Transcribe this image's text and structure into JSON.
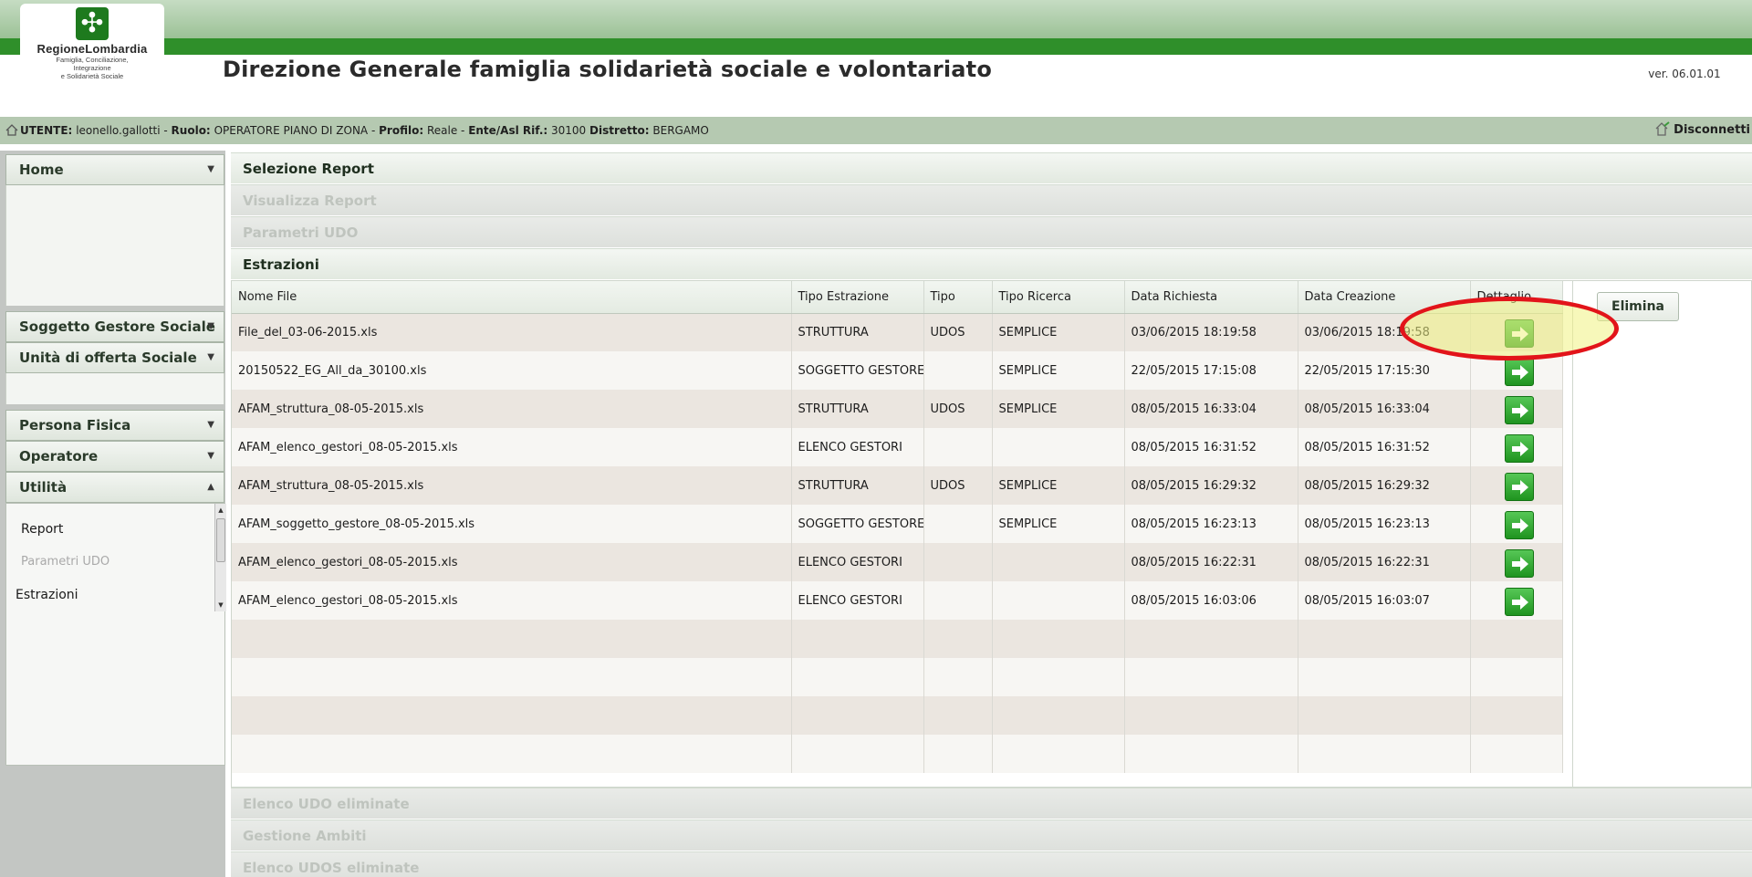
{
  "header": {
    "logo_name": "RegioneLombardia",
    "logo_sub": [
      "Famiglia, Conciliazione,",
      "Integrazione",
      "e Solidarietà Sociale"
    ],
    "title": "Direzione Generale famiglia solidarietà sociale e volontariato",
    "version": "ver. 06.01.01"
  },
  "userbar": {
    "utente_label": "UTENTE:",
    "utente_value": "leonello.gallotti",
    "ruolo_label": "Ruolo:",
    "ruolo_value": "OPERATORE PIANO DI ZONA",
    "profilo_label": "Profilo:",
    "profilo_value": "Reale",
    "ente_label": "Ente/Asl Rif.:",
    "ente_value": "30100",
    "distretto_label": "Distretto:",
    "distretto_value": "BERGAMO",
    "logout": "Disconnetti"
  },
  "sidebar": {
    "home": "Home",
    "soggetto": "Soggetto Gestore Sociale",
    "unita": "Unità di offerta Sociale",
    "persona": "Persona Fisica",
    "operatore": "Operatore",
    "utilita": "Utilità",
    "links": [
      "Report",
      "Parametri UDO",
      "Estrazioni"
    ]
  },
  "accordion": {
    "selezione": "Selezione Report",
    "visualizza": "Visualizza Report",
    "parametri": "Parametri UDO",
    "estrazioni": "Estrazioni",
    "elenco_udo": "Elenco UDO eliminate",
    "gestione": "Gestione Ambiti",
    "elenco_udos": "Elenco UDOS eliminate"
  },
  "table": {
    "columns": [
      "Nome File",
      "Tipo Estrazione",
      "Tipo",
      "Tipo Ricerca",
      "Data Richiesta",
      "Data Creazione",
      "Dettaglio"
    ],
    "rows": [
      {
        "file": "File_del_03-06-2015.xls",
        "tipo_estrazione": "STRUTTURA",
        "tipo": "UDOS",
        "ricerca": "SEMPLICE",
        "richiesta": "03/06/2015 18:19:58",
        "creazione": "03/06/2015 18:19:58"
      },
      {
        "file": "20150522_EG_All_da_30100.xls",
        "tipo_estrazione": "SOGGETTO GESTORE",
        "tipo": "",
        "ricerca": "SEMPLICE",
        "richiesta": "22/05/2015 17:15:08",
        "creazione": "22/05/2015 17:15:30"
      },
      {
        "file": "AFAM_struttura_08-05-2015.xls",
        "tipo_estrazione": "STRUTTURA",
        "tipo": "UDOS",
        "ricerca": "SEMPLICE",
        "richiesta": "08/05/2015 16:33:04",
        "creazione": "08/05/2015 16:33:04"
      },
      {
        "file": "AFAM_elenco_gestori_08-05-2015.xls",
        "tipo_estrazione": "ELENCO GESTORI",
        "tipo": "",
        "ricerca": "",
        "richiesta": "08/05/2015 16:31:52",
        "creazione": "08/05/2015 16:31:52"
      },
      {
        "file": "AFAM_struttura_08-05-2015.xls",
        "tipo_estrazione": "STRUTTURA",
        "tipo": "UDOS",
        "ricerca": "SEMPLICE",
        "richiesta": "08/05/2015 16:29:32",
        "creazione": "08/05/2015 16:29:32"
      },
      {
        "file": "AFAM_soggetto_gestore_08-05-2015.xls",
        "tipo_estrazione": "SOGGETTO GESTORE",
        "tipo": "",
        "ricerca": "SEMPLICE",
        "richiesta": "08/05/2015 16:23:13",
        "creazione": "08/05/2015 16:23:13"
      },
      {
        "file": "AFAM_elenco_gestori_08-05-2015.xls",
        "tipo_estrazione": "ELENCO GESTORI",
        "tipo": "",
        "ricerca": "",
        "richiesta": "08/05/2015 16:22:31",
        "creazione": "08/05/2015 16:22:31"
      },
      {
        "file": "AFAM_elenco_gestori_08-05-2015.xls",
        "tipo_estrazione": "ELENCO GESTORI",
        "tipo": "",
        "ricerca": "",
        "richiesta": "08/05/2015 16:03:06",
        "creazione": "08/05/2015 16:03:07"
      }
    ],
    "detail_icon": "arrow-right-icon",
    "elimina": "Elimina"
  },
  "colors": {
    "brand_green": "#2f8f2a",
    "button_green": "#1f941f",
    "highlight_red": "#e2141a"
  }
}
